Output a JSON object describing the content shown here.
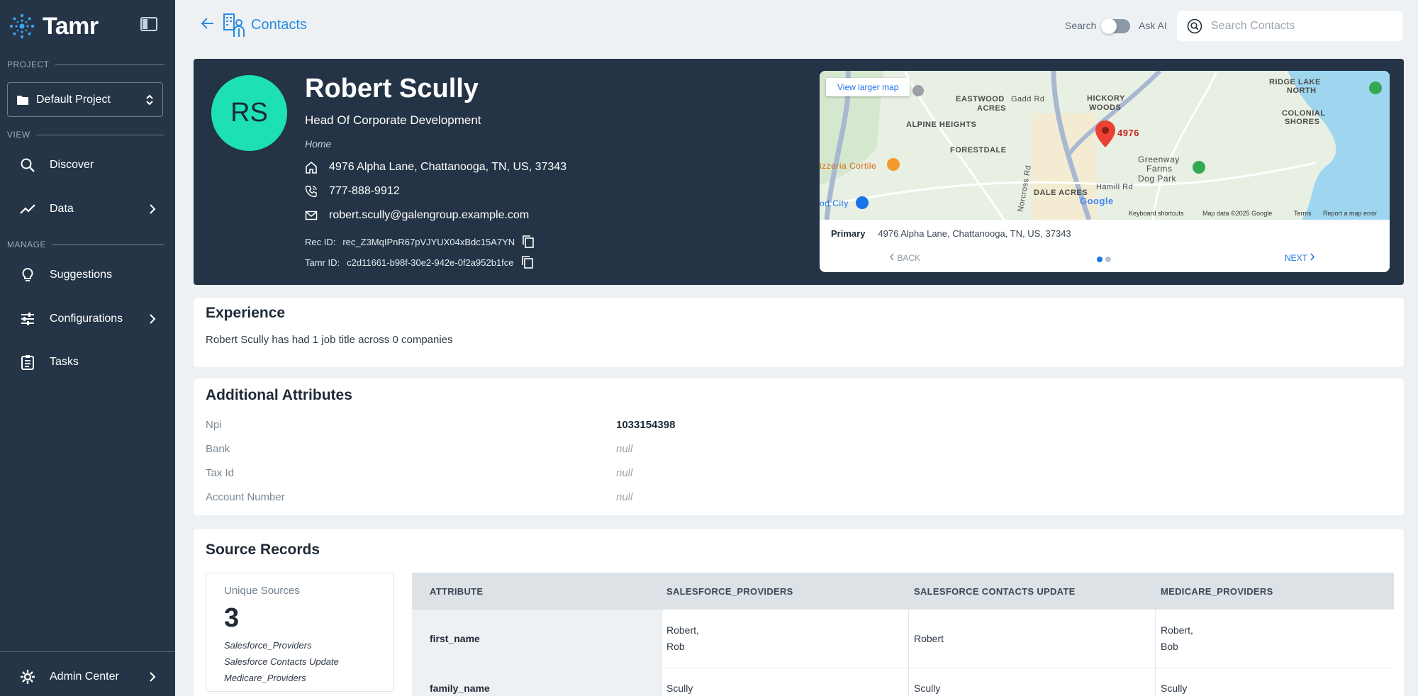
{
  "app": {
    "name": "Tamr"
  },
  "sidebar": {
    "project_label": "PROJECT",
    "project_name": "Default Project",
    "view_label": "VIEW",
    "manage_label": "MANAGE",
    "items": [
      {
        "label": "Discover",
        "icon": "search-icon"
      },
      {
        "label": "Data",
        "icon": "trend-icon"
      },
      {
        "label": "Suggestions",
        "icon": "lightbulb-icon"
      },
      {
        "label": "Configurations",
        "icon": "sliders-icon"
      },
      {
        "label": "Tasks",
        "icon": "clipboard-icon"
      }
    ],
    "admin_label": "Admin Center"
  },
  "header": {
    "breadcrumb": "Contacts",
    "search_label": "Search",
    "ask_label": "Ask AI",
    "search_placeholder": "Search Contacts"
  },
  "profile": {
    "initials": "RS",
    "name": "Robert Scully",
    "title": "Head Of Corporate Development",
    "address_type": "Home",
    "address": "4976 Alpha Lane, Chattanooga, TN, US, 37343",
    "phone": "777-888-9912",
    "email": "robert.scully@galengroup.example.com",
    "rec_id_label": "Rec ID:",
    "rec_id": "rec_Z3MqIPnR67pVJYUX04xBdc15A7YN",
    "tamr_id_label": "Tamr ID:",
    "tamr_id": "c2d11661-b98f-30e2-942e-0f2a952b1fce"
  },
  "map": {
    "view_larger": "View larger map",
    "labels": {
      "eastwood": "EASTWOOD",
      "acres": "ACRES",
      "gadd": "Gadd Rd",
      "hickory": "HICKORY",
      "woods": "WOODS",
      "ridge_lake": "RIDGE LAKE",
      "north": "NORTH",
      "colonial": "COLONIAL",
      "shores": "SHORES",
      "alpine": "ALPINE HEIGHTS",
      "forestdale": "FORESTDALE",
      "greenway": "Greenway",
      "farms": "Farms",
      "dog_park": "Dog Park",
      "pizzeria": "izzeria Cortile",
      "dale_acres": "DALE ACRES",
      "hamill": "Hamill Rd",
      "norcross": "Norcross Rd",
      "od_city": "od City",
      "pin": "4976",
      "google": "Google"
    },
    "footer": {
      "shortcuts": "Keyboard shortcuts",
      "data": "Map data ©2025 Google",
      "terms": "Terms",
      "report": "Report a map error"
    },
    "primary_label": "Primary",
    "primary_address": "4976 Alpha Lane, Chattanooga, TN, US, 37343",
    "back_label": "BACK",
    "next_label": "NEXT"
  },
  "experience": {
    "title": "Experience",
    "summary": "Robert Scully has had 1 job title across 0 companies"
  },
  "attributes": {
    "title": "Additional Attributes",
    "rows": [
      {
        "label": "Npi",
        "value": "1033154398"
      },
      {
        "label": "Bank",
        "value": "null"
      },
      {
        "label": "Tax Id",
        "value": "null"
      },
      {
        "label": "Account Number",
        "value": "null"
      }
    ]
  },
  "sources": {
    "title": "Source Records",
    "unique_label": "Unique Sources",
    "count": "3",
    "list": [
      "Salesforce_Providers",
      "Salesforce Contacts Update",
      "Medicare_Providers"
    ],
    "columns": [
      "ATTRIBUTE",
      "SALESFORCE_PROVIDERS",
      "SALESFORCE CONTACTS UPDATE",
      "MEDICARE_PROVIDERS"
    ],
    "rows": [
      {
        "attr": "first_name",
        "c1": [
          "Robert,",
          "Rob"
        ],
        "c2": "Robert",
        "c3": [
          "Robert,",
          "Bob"
        ]
      },
      {
        "attr": "family_name",
        "c1": "Scully",
        "c2": "Scully",
        "c3": "Scully"
      }
    ]
  }
}
